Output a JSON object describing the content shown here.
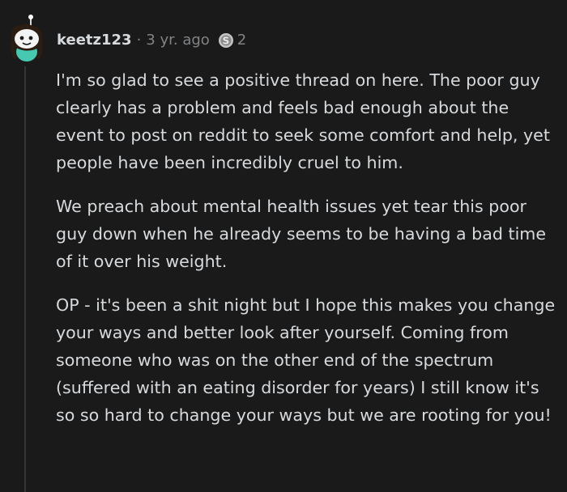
{
  "comment": {
    "username": "keetz123",
    "separator": "·",
    "timestamp": "3 yr. ago",
    "award_count": "2",
    "avatar_icon": "snoo-avatar-icon",
    "award_icon": "silver-award-icon",
    "paragraphs": [
      "I'm so glad to see a positive thread on here. The poor guy clearly has a problem and feels bad enough about the event to post on reddit to seek some comfort and help, yet people have been incredibly cruel to him.",
      "We preach about mental health issues yet tear this poor guy down when he already seems to be having a bad time of it over his weight.",
      "OP - it's been a shit night but I hope this makes you change your ways and better look after yourself. Coming from someone who was on the other end of the spectrum (suffered with an eating disorder for years) I still know it's so so hard to change your ways but we are rooting for you!"
    ]
  },
  "colors": {
    "background": "#1a1a1b",
    "text": "#d7dadc",
    "muted": "#818384",
    "avatar_shirt": "#46c9b0"
  }
}
